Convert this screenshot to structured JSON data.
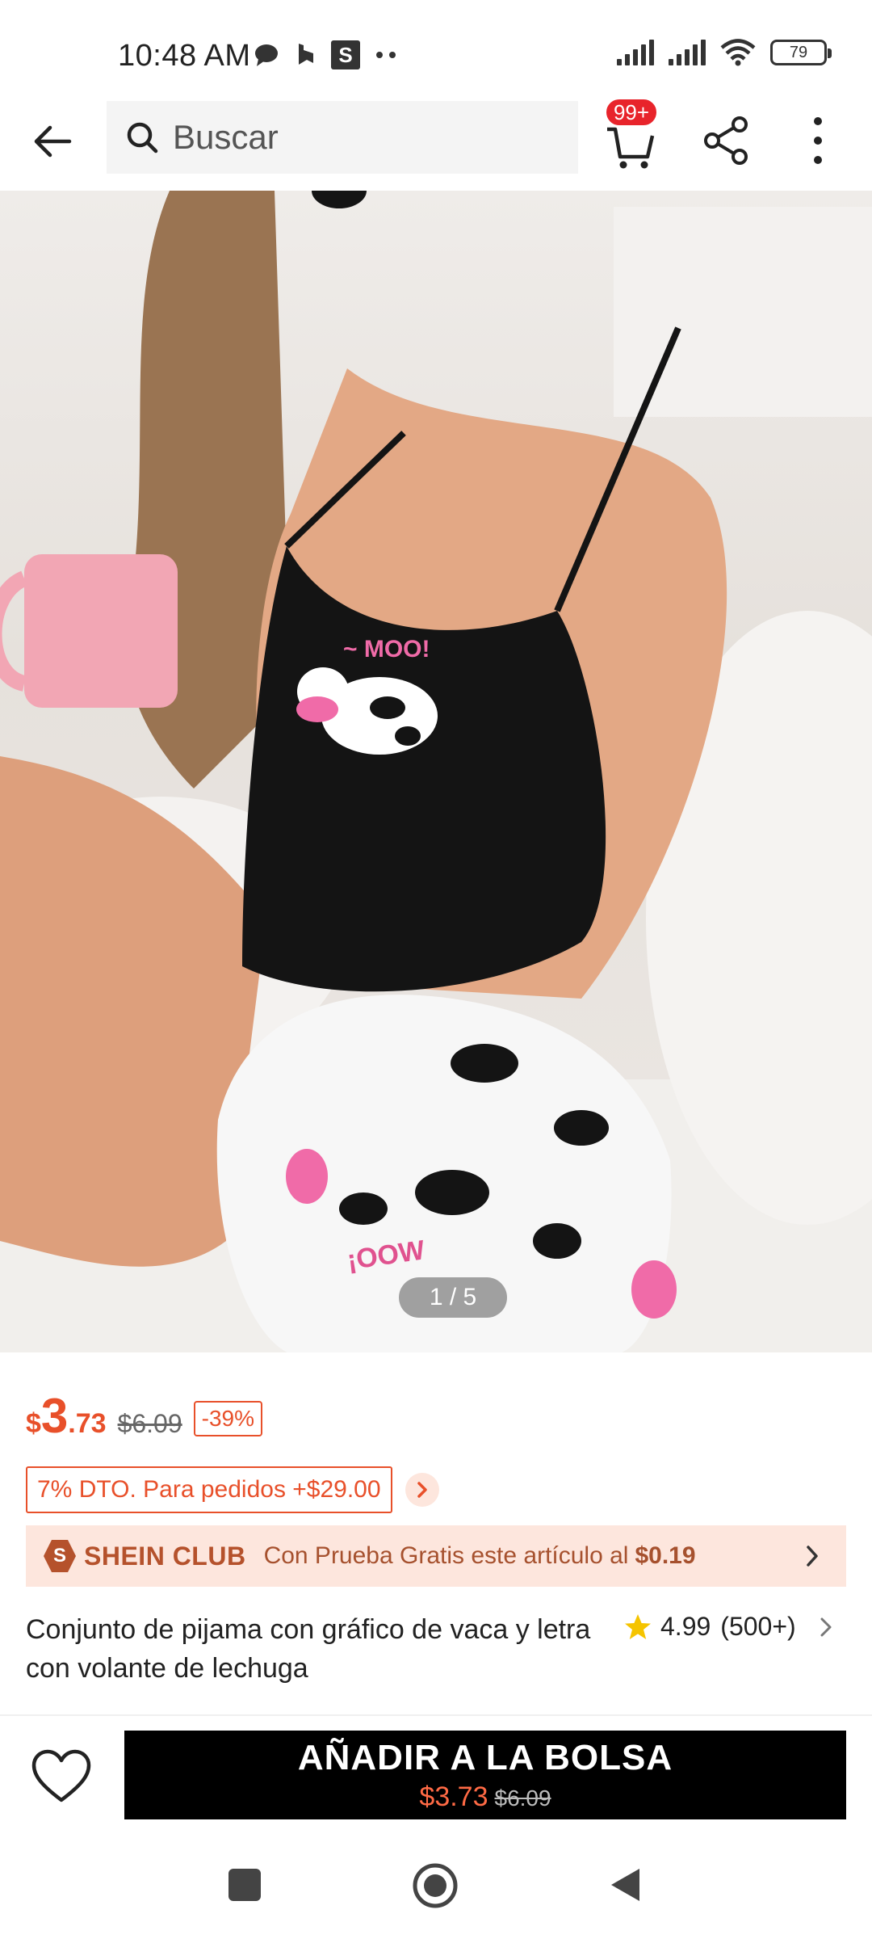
{
  "status_bar": {
    "time": "10:48 AM",
    "battery": "79",
    "icons": [
      "chat-bubble-icon",
      "b-app-icon",
      "s-app-icon",
      "more-dots-icon",
      "signal-icon",
      "signal-icon",
      "wifi-icon",
      "battery-icon"
    ]
  },
  "nav": {
    "search_placeholder": "Buscar",
    "cart_badge": "99+"
  },
  "gallery": {
    "indicator": "1 / 5",
    "graphic_text": "~ MOO!",
    "print_text": "¡OOW"
  },
  "price": {
    "currency": "$",
    "integer": "3",
    "decimal": ".73",
    "original": "$6.09",
    "discount": "-39%"
  },
  "promo": {
    "text": "7% DTO. Para pedidos +$29.00"
  },
  "club": {
    "logo_letter": "S",
    "name": "SHEIN CLUB",
    "text": "Con Prueba Gratis este artículo al",
    "price": "$0.19"
  },
  "product": {
    "title": "Conjunto de pijama con gráfico de vaca y letra con volante de lechuga",
    "rating": "4.99",
    "reviews": "(500+)"
  },
  "bottom_bar": {
    "add_label": "AÑADIR A LA BOLSA",
    "price": "$3.73",
    "original": "$6.09"
  },
  "colors": {
    "accent": "#e8502a",
    "club_bg": "#fde6dd",
    "badge": "#e8242b",
    "button": "#000000"
  }
}
